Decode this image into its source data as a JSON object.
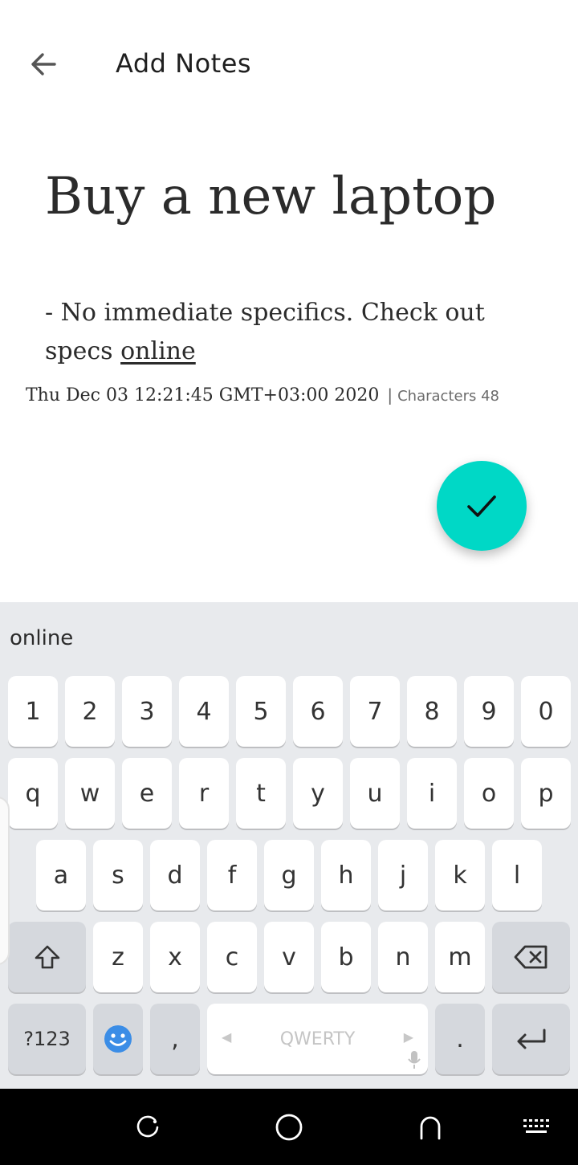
{
  "app_bar": {
    "title": "Add Notes",
    "back_icon": "arrow-left-icon"
  },
  "note": {
    "title": "Buy a new laptop",
    "body_text": "- No immediate specifics. Check out specs ",
    "body_link": "online",
    "timestamp": "Thu Dec 03 12:21:45 GMT+03:00 2020",
    "separator": "|",
    "char_count": "Characters 48"
  },
  "fab": {
    "icon": "check-icon",
    "color": "#00d8c6"
  },
  "keyboard": {
    "suggestion": "online",
    "number_row": [
      "1",
      "2",
      "3",
      "4",
      "5",
      "6",
      "7",
      "8",
      "9",
      "0"
    ],
    "row1": [
      "q",
      "w",
      "e",
      "r",
      "t",
      "y",
      "u",
      "i",
      "o",
      "p"
    ],
    "row2": [
      "a",
      "s",
      "d",
      "f",
      "g",
      "h",
      "j",
      "k",
      "l"
    ],
    "row3": [
      "z",
      "x",
      "c",
      "v",
      "b",
      "n",
      "m"
    ],
    "symbols_key": "?123",
    "comma_key": ",",
    "space_label": "QWERTY",
    "period_key": ".",
    "colors": {
      "background": "#e8eaed",
      "key": "#ffffff",
      "function_key": "#d5d8dd"
    }
  },
  "nav_bar": {
    "buttons": [
      "recent-apps-icon",
      "home-icon",
      "back-icon",
      "keyboard-switch-icon"
    ]
  }
}
